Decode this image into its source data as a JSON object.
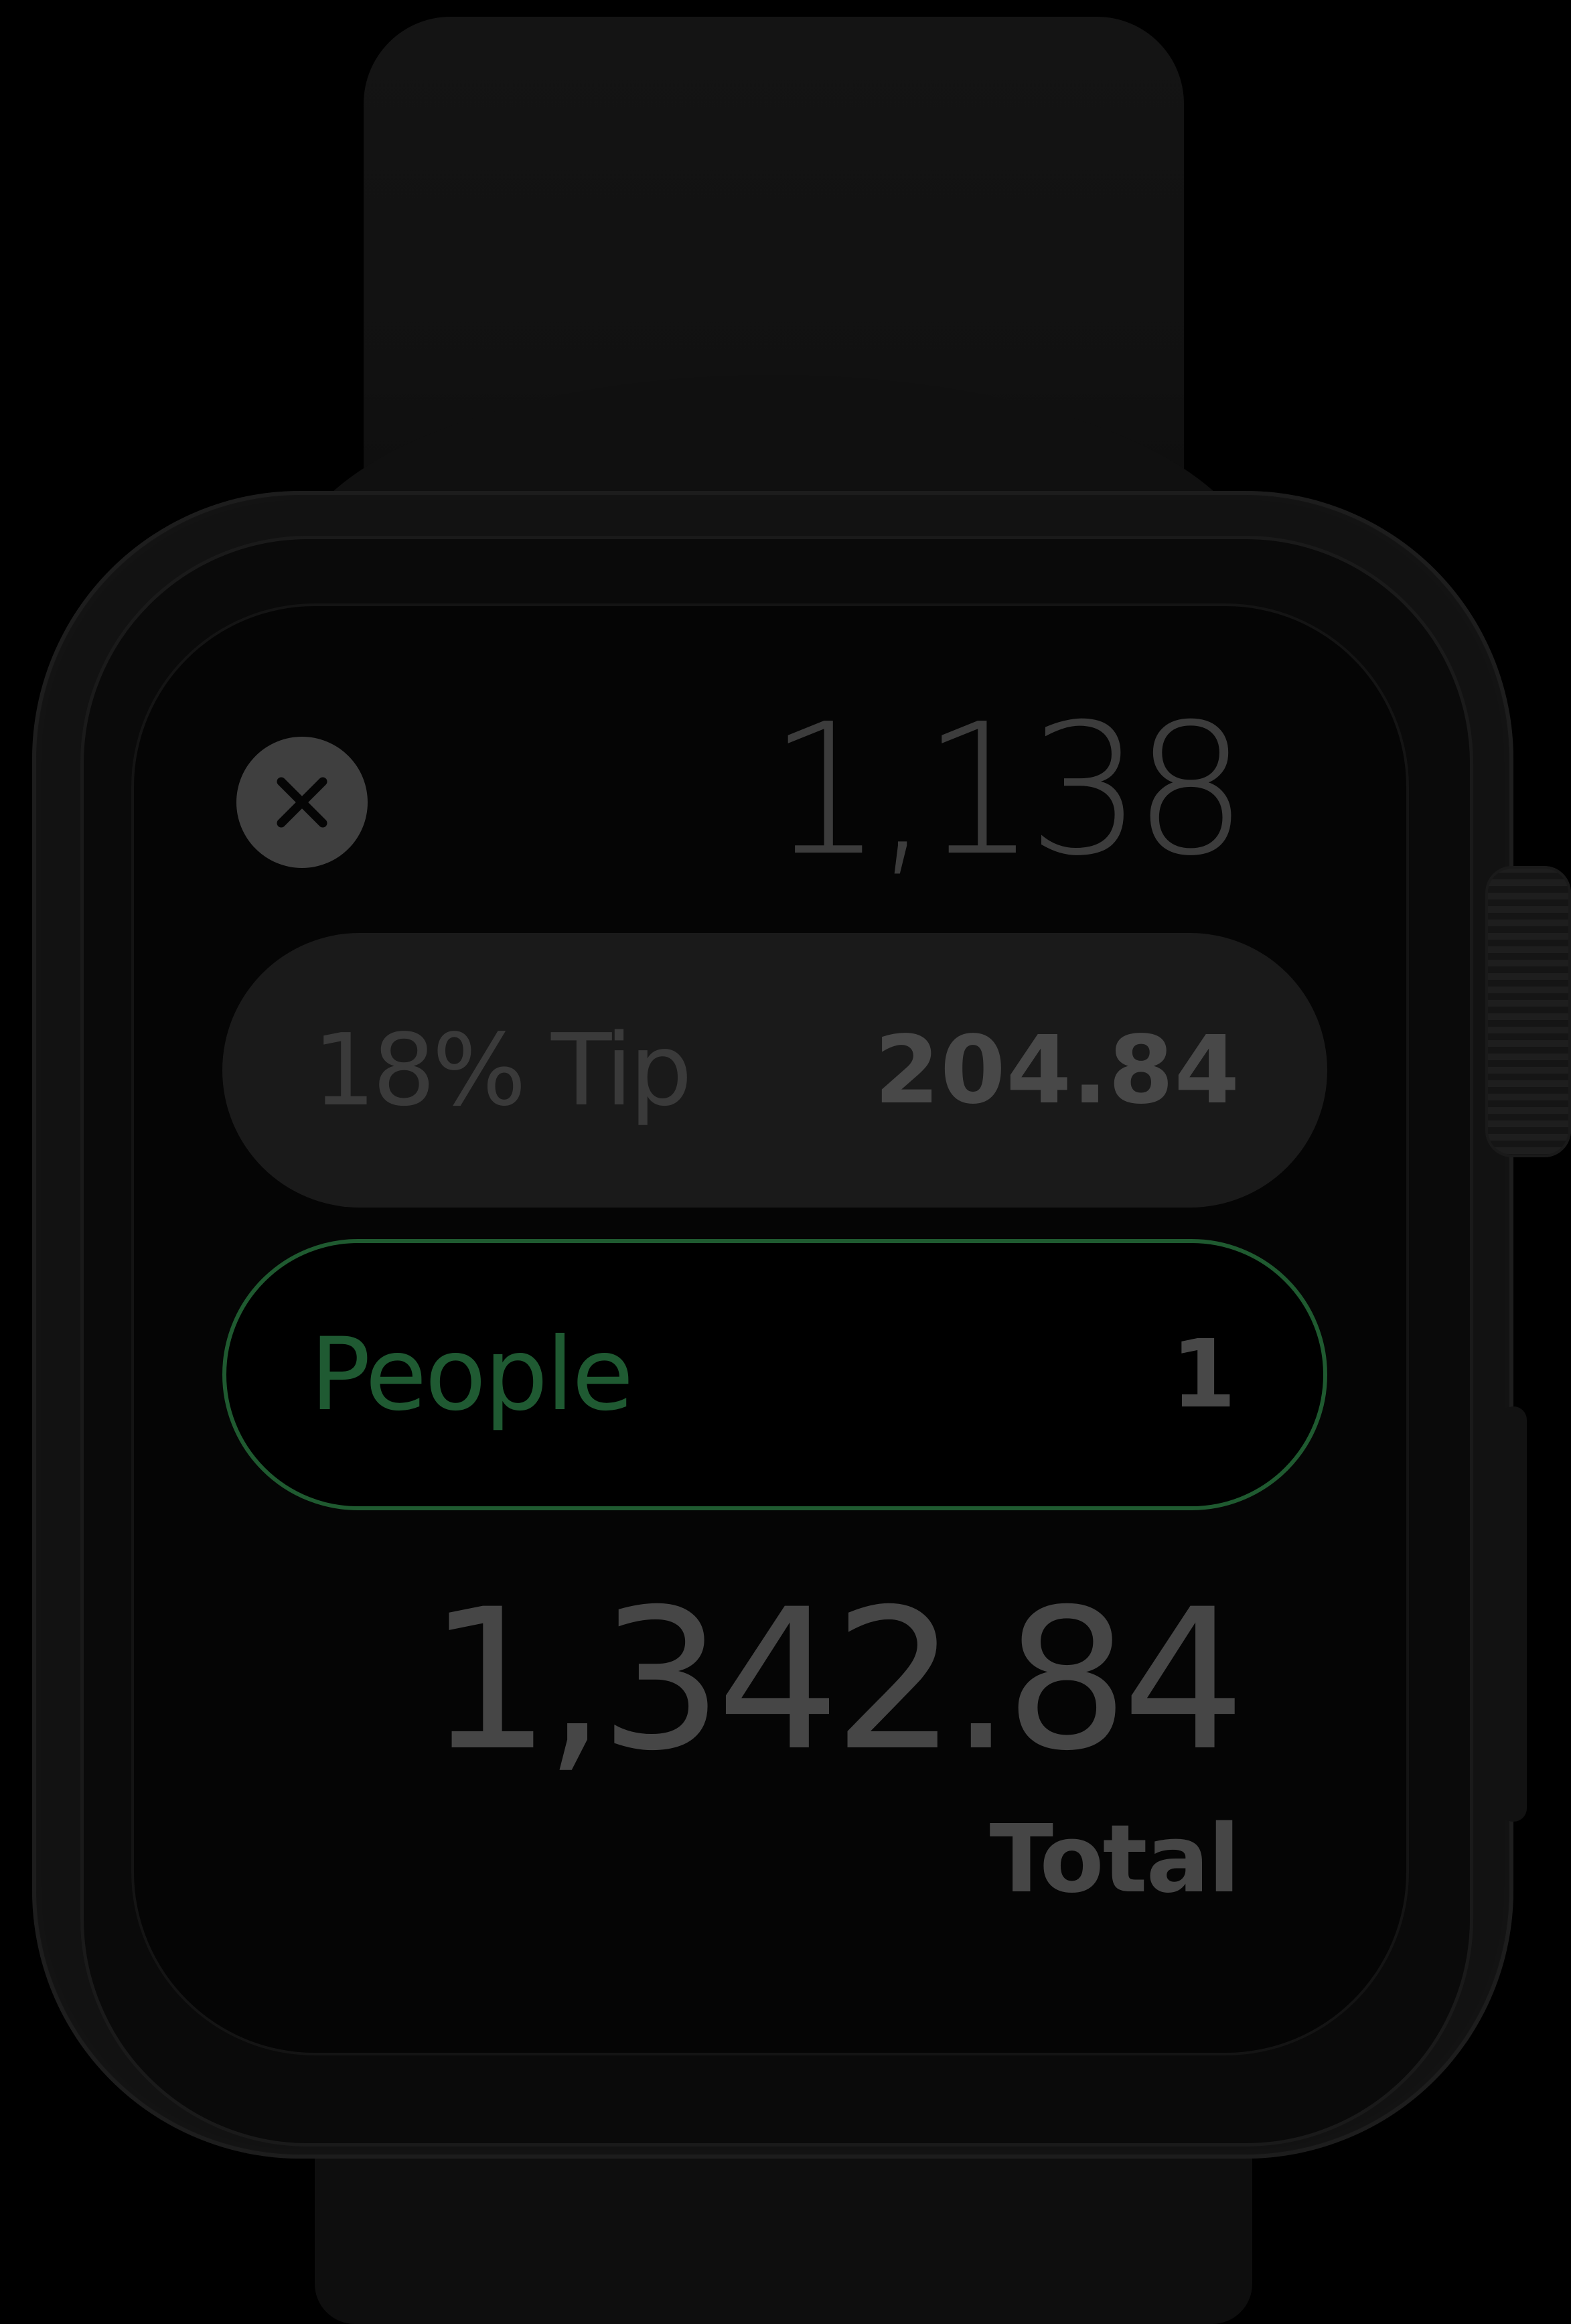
{
  "colors": {
    "background": "#000000",
    "pill_background": "#1a1a1a",
    "people_accent": "#1f5a30",
    "muted_text": "#464646",
    "close_button": "#3f3f3f"
  },
  "bill": {
    "amount": "1,138"
  },
  "close_button": {
    "icon": "close-icon"
  },
  "tip": {
    "label": "18% Tip",
    "value": "204.84"
  },
  "people": {
    "label": "People",
    "value": "1"
  },
  "total": {
    "amount": "1,342.84",
    "label": "Total"
  }
}
